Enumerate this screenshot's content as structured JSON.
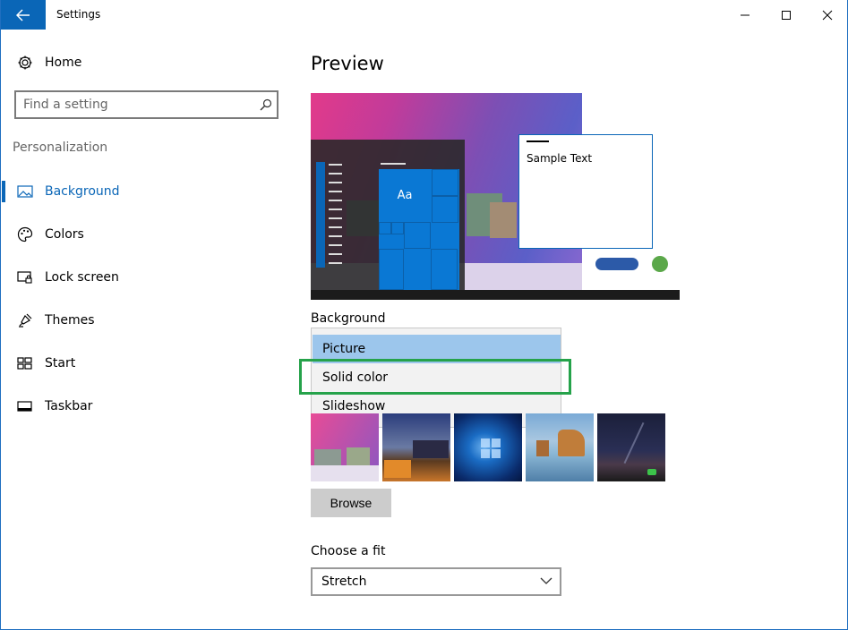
{
  "window": {
    "title": "Settings"
  },
  "sidebar": {
    "home_label": "Home",
    "search_placeholder": "Find a setting",
    "section_label": "Personalization",
    "items": [
      {
        "label": "Background",
        "icon": "picture-icon",
        "active": true
      },
      {
        "label": "Colors",
        "icon": "palette-icon",
        "active": false
      },
      {
        "label": "Lock screen",
        "icon": "lock-screen-icon",
        "active": false
      },
      {
        "label": "Themes",
        "icon": "themes-icon",
        "active": false
      },
      {
        "label": "Start",
        "icon": "start-icon",
        "active": false
      },
      {
        "label": "Taskbar",
        "icon": "taskbar-icon",
        "active": false
      }
    ]
  },
  "main": {
    "preview_title": "Preview",
    "preview": {
      "tile_label": "Aa",
      "sample_text": "Sample Text"
    },
    "background_label": "Background",
    "background_options": [
      {
        "label": "Picture",
        "selected": true
      },
      {
        "label": "Solid color",
        "selected": false
      },
      {
        "label": "Slideshow",
        "selected": false
      }
    ],
    "browse_label": "Browse",
    "fit_label": "Choose a fit",
    "fit_value": "Stretch"
  },
  "colors": {
    "accent": "#0a66b7",
    "highlight_box": "#25a24a",
    "selected_option": "#9cc6ec"
  }
}
